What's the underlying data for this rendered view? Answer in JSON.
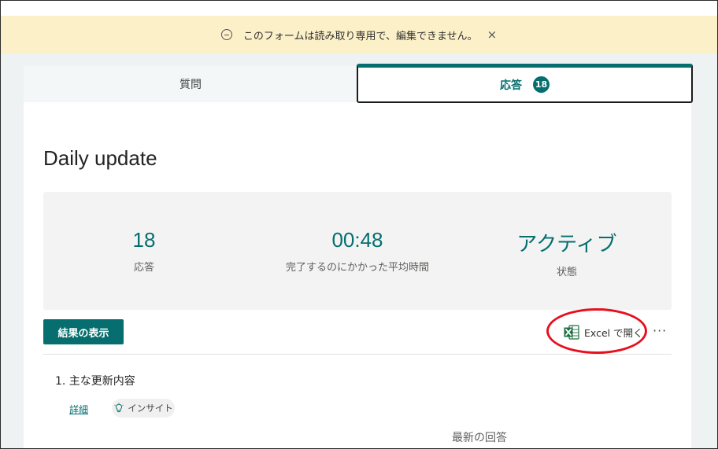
{
  "banner": {
    "message": "このフォームは読み取り専用で、編集できません。",
    "close": "×"
  },
  "tabs": {
    "questions": "質問",
    "responses": "応答",
    "response_count": "18"
  },
  "form": {
    "title": "Daily update"
  },
  "stats": [
    {
      "value": "18",
      "label": "応答"
    },
    {
      "value": "00:48",
      "label": "完了するのにかかった平均時間"
    },
    {
      "value": "アクティブ",
      "label": "状態"
    }
  ],
  "toolbar": {
    "view_results": "結果の表示",
    "open_in_excel": "Excel で開く",
    "more": "···"
  },
  "question": {
    "title": "1. 主な更新内容",
    "details": "詳細",
    "insights": "インサイト",
    "latest_responses": "最新の回答"
  },
  "colors": {
    "accent": "#066e6e",
    "banner_bg": "#fbf0c8",
    "annotation": "#e8101e",
    "excel_green": "#1d6f42"
  }
}
